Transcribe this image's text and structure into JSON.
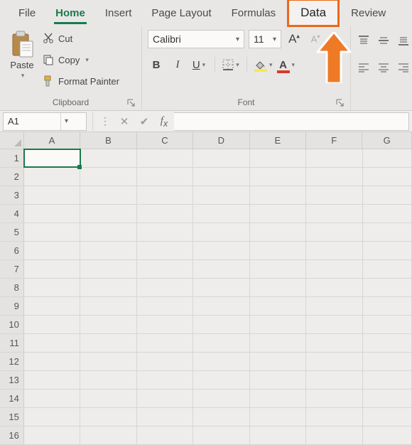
{
  "tabs": {
    "file": "File",
    "home": "Home",
    "insert": "Insert",
    "page_layout": "Page Layout",
    "formulas": "Formulas",
    "data": "Data",
    "review": "Review"
  },
  "clipboard": {
    "paste": "Paste",
    "cut": "Cut",
    "copy": "Copy",
    "format_painter": "Format Painter",
    "group_label": "Clipboard"
  },
  "font": {
    "name": "Calibri",
    "size": "11",
    "group_label": "Font"
  },
  "namebox": {
    "value": "A1"
  },
  "columns": [
    "A",
    "B",
    "C",
    "D",
    "E",
    "F",
    "G"
  ],
  "rows": [
    "1",
    "2",
    "3",
    "4",
    "5",
    "6",
    "7",
    "8",
    "9",
    "10",
    "11",
    "12",
    "13",
    "14",
    "15",
    "16"
  ],
  "active_cell": {
    "row": 0,
    "col": 0
  },
  "colors": {
    "accent": "#1a7a4c",
    "callout": "#e86a1a",
    "highlight_fill": "#f9e94b",
    "font_color": "#d83b2b"
  }
}
